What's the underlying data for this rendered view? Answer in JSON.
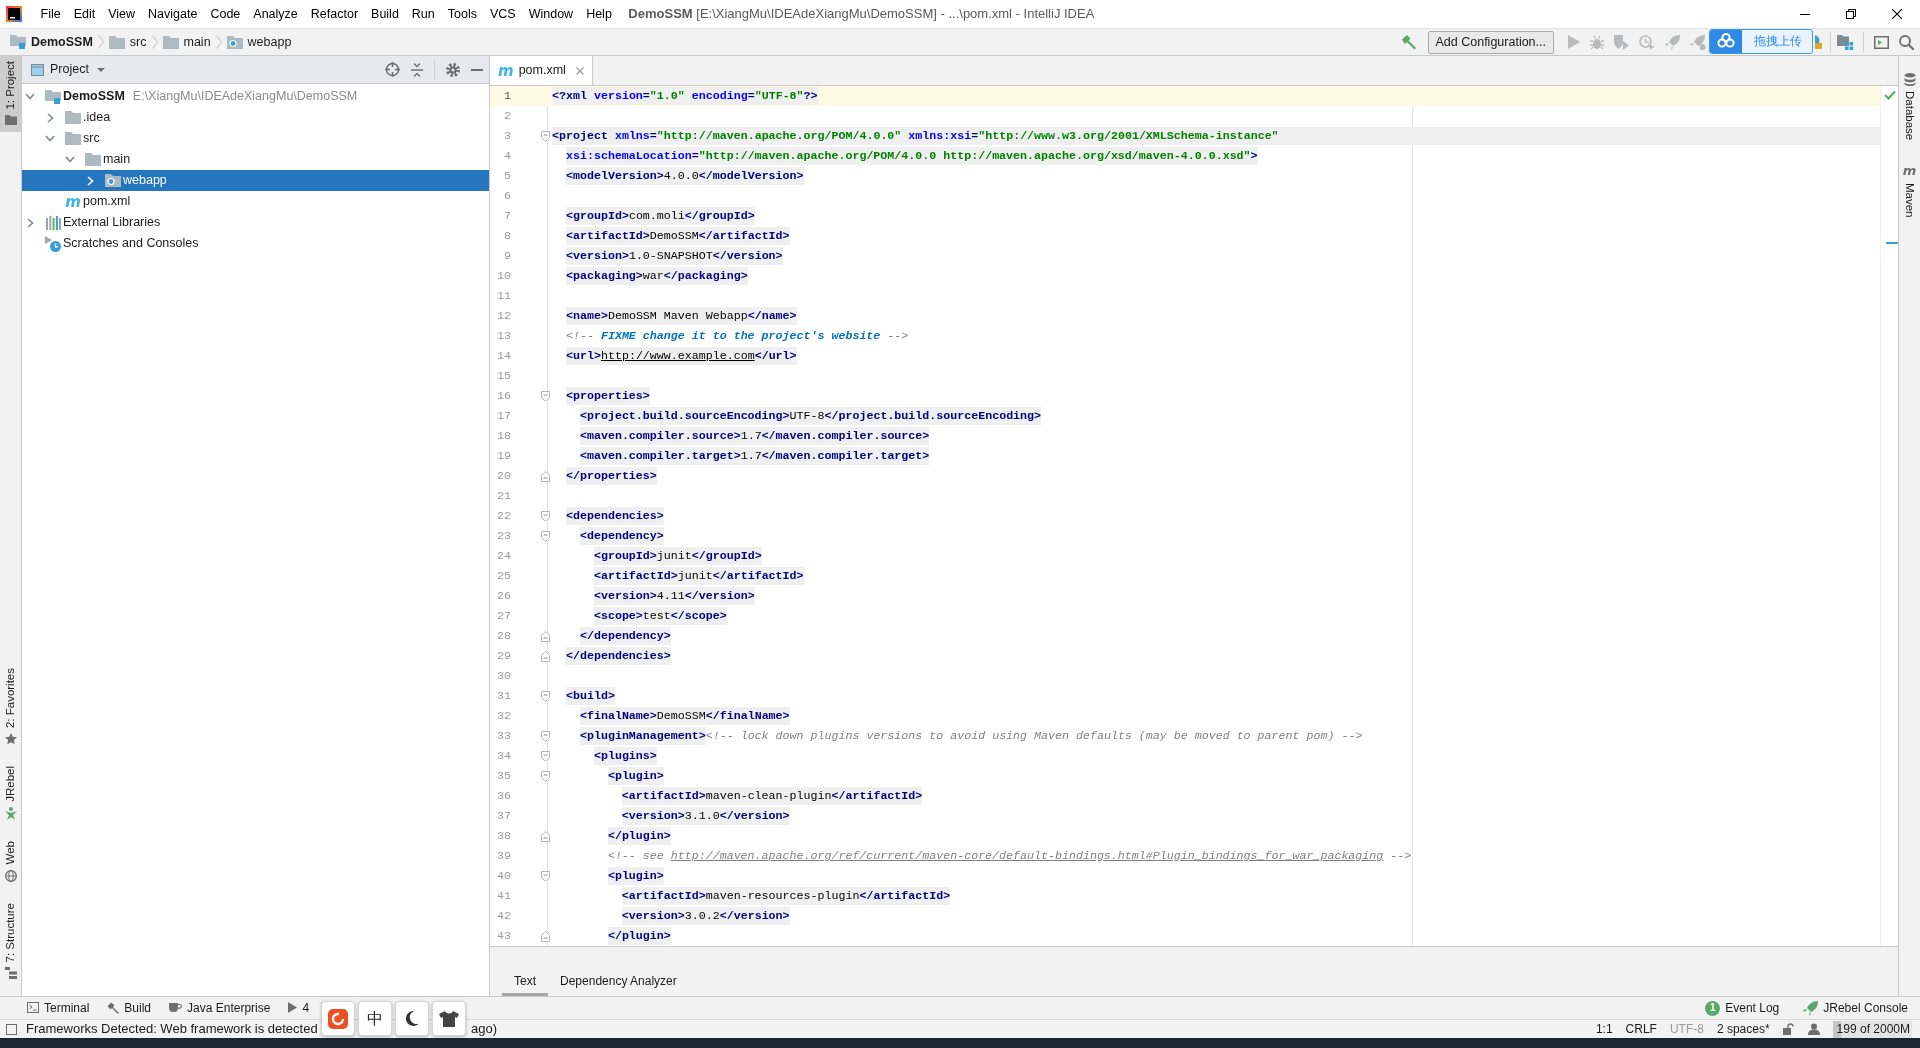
{
  "window": {
    "title": "**DemoSSM** [E:\\XiangMu\\IDEAdeXiangMu\\DemoSSM] - ...\\pom.xml - IntelliJ IDEA"
  },
  "menu": [
    "File",
    "Edit",
    "View",
    "Navigate",
    "Code",
    "Analyze",
    "Refactor",
    "Build",
    "Run",
    "Tools",
    "VCS",
    "Window",
    "Help"
  ],
  "breadcrumbs": [
    {
      "label": "DemoSSM",
      "kind": "module"
    },
    {
      "label": "src",
      "kind": "folder"
    },
    {
      "label": "main",
      "kind": "folder"
    },
    {
      "label": "webapp",
      "kind": "web_folder"
    }
  ],
  "toolbar": {
    "build_actions": [
      {
        "kind": "build",
        "disabled": false
      }
    ],
    "run_configuration": "Add Configuration...",
    "run_actions": [
      {
        "kind": "run",
        "disabled": true
      },
      {
        "kind": "debug",
        "disabled": true
      },
      {
        "kind": "coverage",
        "disabled": true
      },
      {
        "kind": "profile",
        "disabled": true
      },
      {
        "kind": "rocket",
        "disabled": true
      },
      {
        "kind": "rocket_debug",
        "disabled": true
      }
    ]
  },
  "upload_widget": {
    "label": "拖拽上传"
  },
  "left_tool_strip": {
    "top": [
      {
        "label": "1: Project",
        "kind": "project",
        "selected": true
      }
    ],
    "bottom": [
      {
        "label": "2: Favorites",
        "kind": "favorites",
        "selected": false
      },
      {
        "label": "JRebel",
        "kind": "jrebel",
        "selected": false
      },
      {
        "label": "Web",
        "kind": "web",
        "selected": false
      },
      {
        "label": "7: Structure",
        "kind": "structure",
        "selected": false
      }
    ]
  },
  "project_panel": {
    "title": "Project",
    "tree": [
      {
        "label": "DemoSSM",
        "path": "E:\\XiangMu\\IDEAdeXiangMu\\DemoSSM",
        "kind": "module",
        "expanded": true,
        "selected": false,
        "children": [
          {
            "label": ".idea",
            "kind": "folder",
            "expanded": false,
            "selected": false
          },
          {
            "label": "src",
            "kind": "folder",
            "expanded": true,
            "selected": false,
            "children": [
              {
                "label": "main",
                "kind": "folder",
                "expanded": true,
                "selected": false,
                "children": [
                  {
                    "label": "webapp",
                    "kind": "web_folder",
                    "expanded": false,
                    "selected": true
                  }
                ]
              }
            ]
          },
          {
            "label": "pom.xml",
            "kind": "maven_file",
            "icon_text": "m",
            "selected": false
          }
        ]
      },
      {
        "label": "External Libraries",
        "kind": "libraries",
        "expanded": false,
        "selected": false
      },
      {
        "label": "Scratches and Consoles",
        "kind": "scratches",
        "selected": false
      }
    ]
  },
  "editor": {
    "tabs": [
      {
        "label": "pom.xml",
        "icon_text": "m",
        "selected": true
      }
    ],
    "lines": [
      {
        "number": "1",
        "current": true,
        "tokens": [
          {
            "kind": "tag",
            "text": "<?xml version=\"1.0\" encoding=\"UTF-8\"?>"
          }
        ]
      },
      {
        "number": "2",
        "current": false
      },
      {
        "number": "3",
        "current": false,
        "fold": {
          "kind": "start"
        },
        "tokens": [
          {
            "kind": "tag",
            "text": "<project xmlns=\"http://maven.apache.org/POM/4.0.0\" xmlns:xsi=\"http://www.w3.org/2001/XMLSchema-instance\""
          }
        ]
      },
      {
        "number": "4",
        "current": false,
        "tokens": [
          {
            "kind": "tag",
            "text": "  xsi:schemaLocation=\"http://maven.apache.org/POM/4.0.0 http://maven.apache.org/xsd/maven-4.0.0.xsd\">"
          }
        ]
      },
      {
        "number": "5",
        "current": false,
        "tokens": [
          {
            "kind": "tag",
            "text": "  <modelVersion>"
          },
          {
            "kind": "text",
            "text": "4.0.0"
          },
          {
            "kind": "tag",
            "text": "</modelVersion>"
          }
        ]
      },
      {
        "number": "6",
        "current": false
      },
      {
        "number": "7",
        "current": false,
        "tokens": [
          {
            "kind": "tag",
            "text": "  <groupId>"
          },
          {
            "kind": "text",
            "text": "com.moli"
          },
          {
            "kind": "tag",
            "text": "</groupId>"
          }
        ]
      },
      {
        "number": "8",
        "current": false,
        "tokens": [
          {
            "kind": "tag",
            "text": "  <artifactId>"
          },
          {
            "kind": "text",
            "text": "DemoSSM"
          },
          {
            "kind": "tag",
            "text": "</artifactId>"
          }
        ]
      },
      {
        "number": "9",
        "current": false,
        "tokens": [
          {
            "kind": "tag",
            "text": "  <version>"
          },
          {
            "kind": "text",
            "text": "1.0-SNAPSHOT"
          },
          {
            "kind": "tag",
            "text": "</version>"
          }
        ]
      },
      {
        "number": "10",
        "current": false,
        "tokens": [
          {
            "kind": "tag",
            "text": "  <packaging>"
          },
          {
            "kind": "text",
            "text": "war"
          },
          {
            "kind": "tag",
            "text": "</packaging>"
          }
        ]
      },
      {
        "number": "11",
        "current": false
      },
      {
        "number": "12",
        "current": false,
        "tokens": [
          {
            "kind": "tag",
            "text": "  <name>"
          },
          {
            "kind": "text",
            "text": "DemoSSM Maven Webapp"
          },
          {
            "kind": "tag",
            "text": "</name>"
          }
        ]
      },
      {
        "number": "13",
        "current": false,
        "tokens": [
          {
            "kind": "comment",
            "text": "  <!-- "
          },
          {
            "kind": "todo",
            "text": "FIXME change it to the project's website"
          },
          {
            "kind": "comment",
            "text": " -->"
          }
        ]
      },
      {
        "number": "14",
        "current": false,
        "tokens": [
          {
            "kind": "tag",
            "text": "  <url>"
          },
          {
            "kind": "url",
            "text": "http://www.example.com"
          },
          {
            "kind": "tag",
            "text": "</url>"
          }
        ]
      },
      {
        "number": "15",
        "current": false
      },
      {
        "number": "16",
        "current": false,
        "fold": {
          "kind": "start"
        },
        "tokens": [
          {
            "kind": "tag",
            "text": "  <properties>"
          }
        ]
      },
      {
        "number": "17",
        "current": false,
        "tokens": [
          {
            "kind": "tag",
            "text": "    <project.build.sourceEncoding>"
          },
          {
            "kind": "text",
            "text": "UTF-8"
          },
          {
            "kind": "tag",
            "text": "</project.build.sourceEncoding>"
          }
        ]
      },
      {
        "number": "18",
        "current": false,
        "tokens": [
          {
            "kind": "tag",
            "text": "    <maven.compiler.source>"
          },
          {
            "kind": "text",
            "text": "1.7"
          },
          {
            "kind": "tag",
            "text": "</maven.compiler.source>"
          }
        ]
      },
      {
        "number": "19",
        "current": false,
        "tokens": [
          {
            "kind": "tag",
            "text": "    <maven.compiler.target>"
          },
          {
            "kind": "text",
            "text": "1.7"
          },
          {
            "kind": "tag",
            "text": "</maven.compiler.target>"
          }
        ]
      },
      {
        "number": "20",
        "current": false,
        "fold": {
          "kind": "end"
        },
        "tokens": [
          {
            "kind": "tag",
            "text": "  </properties>"
          }
        ]
      },
      {
        "number": "21",
        "current": false
      },
      {
        "number": "22",
        "current": false,
        "fold": {
          "kind": "start"
        },
        "tokens": [
          {
            "kind": "tag",
            "text": "  <dependencies>"
          }
        ]
      },
      {
        "number": "23",
        "current": false,
        "fold": {
          "kind": "start"
        },
        "tokens": [
          {
            "kind": "tag",
            "text": "    <dependency>"
          }
        ]
      },
      {
        "number": "24",
        "current": false,
        "tokens": [
          {
            "kind": "tag",
            "text": "      <groupId>"
          },
          {
            "kind": "text",
            "text": "junit"
          },
          {
            "kind": "tag",
            "text": "</groupId>"
          }
        ]
      },
      {
        "number": "25",
        "current": false,
        "tokens": [
          {
            "kind": "tag",
            "text": "      <artifactId>"
          },
          {
            "kind": "text",
            "text": "junit"
          },
          {
            "kind": "tag",
            "text": "</artifactId>"
          }
        ]
      },
      {
        "number": "26",
        "current": false,
        "tokens": [
          {
            "kind": "tag",
            "text": "      <version>"
          },
          {
            "kind": "text",
            "text": "4.11"
          },
          {
            "kind": "tag",
            "text": "</version>"
          }
        ]
      },
      {
        "number": "27",
        "current": false,
        "tokens": [
          {
            "kind": "tag",
            "text": "      <scope>"
          },
          {
            "kind": "text",
            "text": "test"
          },
          {
            "kind": "tag",
            "text": "</scope>"
          }
        ]
      },
      {
        "number": "28",
        "current": false,
        "fold": {
          "kind": "end"
        },
        "tokens": [
          {
            "kind": "tag",
            "text": "    </dependency>"
          }
        ]
      },
      {
        "number": "29",
        "current": false,
        "fold": {
          "kind": "end"
        },
        "tokens": [
          {
            "kind": "tag",
            "text": "  </dependencies>"
          }
        ]
      },
      {
        "number": "30",
        "current": false
      },
      {
        "number": "31",
        "current": false,
        "fold": {
          "kind": "start"
        },
        "tokens": [
          {
            "kind": "tag",
            "text": "  <build>"
          }
        ]
      },
      {
        "number": "32",
        "current": false,
        "tokens": [
          {
            "kind": "tag",
            "text": "    <finalName>"
          },
          {
            "kind": "text",
            "text": "DemoSSM"
          },
          {
            "kind": "tag",
            "text": "</finalName>"
          }
        ]
      },
      {
        "number": "33",
        "current": false,
        "fold": {
          "kind": "start"
        },
        "tokens": [
          {
            "kind": "tag",
            "text": "    <pluginManagement>"
          },
          {
            "kind": "comment",
            "text": "<!-- lock down plugins versions to avoid using Maven defaults (may be moved to parent pom) -->"
          }
        ]
      },
      {
        "number": "34",
        "current": false,
        "fold": {
          "kind": "start"
        },
        "tokens": [
          {
            "kind": "tag",
            "text": "      <plugins>"
          }
        ]
      },
      {
        "number": "35",
        "current": false,
        "fold": {
          "kind": "start"
        },
        "tokens": [
          {
            "kind": "tag",
            "text": "        <plugin>"
          }
        ]
      },
      {
        "number": "36",
        "current": false,
        "tokens": [
          {
            "kind": "tag",
            "text": "          <artifactId>"
          },
          {
            "kind": "text",
            "text": "maven-clean-plugin"
          },
          {
            "kind": "tag",
            "text": "</artifactId>"
          }
        ]
      },
      {
        "number": "37",
        "current": false,
        "tokens": [
          {
            "kind": "tag",
            "text": "          <version>"
          },
          {
            "kind": "text",
            "text": "3.1.0"
          },
          {
            "kind": "tag",
            "text": "</version>"
          }
        ]
      },
      {
        "number": "38",
        "current": false,
        "fold": {
          "kind": "end"
        },
        "tokens": [
          {
            "kind": "tag",
            "text": "        </plugin>"
          }
        ]
      },
      {
        "number": "39",
        "current": false,
        "tokens": [
          {
            "kind": "comment",
            "text": "        <!-- see "
          },
          {
            "kind": "comment_url",
            "text": "http://maven.apache.org/ref/current/maven-core/default-bindings.html#Plugin_bindings_for_war_packaging"
          },
          {
            "kind": "comment",
            "text": " -->"
          }
        ]
      },
      {
        "number": "40",
        "current": false,
        "fold": {
          "kind": "start"
        },
        "tokens": [
          {
            "kind": "tag",
            "text": "        <plugin>"
          }
        ]
      },
      {
        "number": "41",
        "current": false,
        "tokens": [
          {
            "kind": "tag",
            "text": "          <artifactId>"
          },
          {
            "kind": "text",
            "text": "maven-resources-plugin"
          },
          {
            "kind": "tag",
            "text": "</artifactId>"
          }
        ]
      },
      {
        "number": "42",
        "current": false,
        "tokens": [
          {
            "kind": "tag",
            "text": "          <version>"
          },
          {
            "kind": "text",
            "text": "3.0.2"
          },
          {
            "kind": "tag",
            "text": "</version>"
          }
        ]
      },
      {
        "number": "43",
        "current": false,
        "fold": {
          "kind": "end"
        },
        "tokens": [
          {
            "kind": "tag",
            "text": "        </plugin>"
          }
        ]
      }
    ],
    "view_tabs": [
      {
        "label": "Text",
        "selected": true
      },
      {
        "label": "Dependency Analyzer",
        "selected": false
      }
    ]
  },
  "right_tool_strip": [
    {
      "label": "Database",
      "kind": "database",
      "selected": false
    },
    {
      "label": "Maven",
      "kind": "maven",
      "icon_text": "m",
      "selected": false
    }
  ],
  "bottom_tool_strip": {
    "left": [
      {
        "label": "Terminal",
        "kind": "terminal"
      },
      {
        "label": "Build",
        "kind": "build"
      },
      {
        "label": "Java Enterprise",
        "kind": "enterprise"
      },
      {
        "label": "4",
        "kind": "run"
      }
    ],
    "right": [
      {
        "label": "Event Log",
        "kind": "event_log",
        "count": "1"
      },
      {
        "label": "JRebel Console",
        "kind": "jrebel"
      }
    ]
  },
  "status_bar": {
    "message": [
      "Frameworks Detected: Web framework is detected",
      "ago)"
    ],
    "widgets": [
      {
        "text": "1:1",
        "disabled": false
      },
      {
        "text": "CRLF",
        "disabled": false
      },
      {
        "text": "UTF-8",
        "disabled": true
      },
      {
        "text": "2 spaces*",
        "disabled": false
      }
    ],
    "memory": {
      "text": "199 of 2000M",
      "level": 0.1
    }
  },
  "ime_toolbar": {
    "mode": "中"
  }
}
